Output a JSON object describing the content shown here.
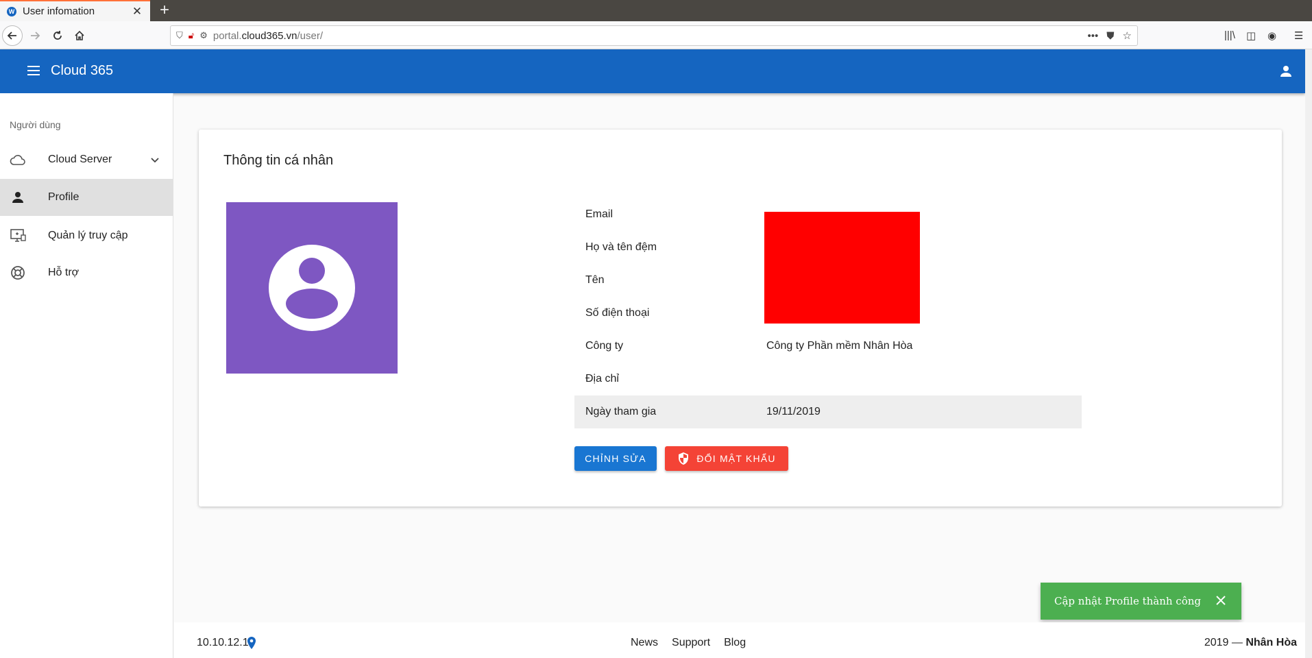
{
  "browser": {
    "tab_title": "User infomation",
    "tab_favicon": "W",
    "url_prefix": "portal.",
    "url_domain": "cloud365.vn",
    "url_path": "/user/"
  },
  "appbar": {
    "title": "Cloud 365"
  },
  "sidebar": {
    "section_title": "Người dùng",
    "items": [
      {
        "label": "Cloud Server",
        "icon": "cloud-icon"
      },
      {
        "label": "Profile",
        "icon": "person-icon"
      },
      {
        "label": "Quản lý truy cập",
        "icon": "monitor-access-icon"
      },
      {
        "label": "Hỗ trợ",
        "icon": "lifebuoy-icon"
      }
    ]
  },
  "profile": {
    "title": "Thông tin cá nhân",
    "rows": [
      {
        "label": "Email",
        "value": ""
      },
      {
        "label": "Họ và tên đệm",
        "value": ""
      },
      {
        "label": "Tên",
        "value": ""
      },
      {
        "label": "Số điện thoại",
        "value": ""
      },
      {
        "label": "Công ty",
        "value": "Công ty Phần mềm Nhân Hòa"
      },
      {
        "label": "Địa chỉ",
        "value": ""
      },
      {
        "label": "Ngày tham gia",
        "value": "19/11/2019"
      }
    ],
    "edit_button": "CHỈNH SỬA",
    "password_button": "ĐỔI MẬT KHẨU"
  },
  "toast": {
    "message": "Cập nhật Profile thành công"
  },
  "footer": {
    "ip": "10.10.12.1",
    "links": [
      "News",
      "Support",
      "Blog"
    ],
    "copyright_year": "2019 —",
    "copyright_name": "Nhân Hòa"
  },
  "colors": {
    "primary": "#1565c0",
    "avatar_bg": "#7e57c2",
    "danger": "#f44336",
    "success": "#4caf50"
  }
}
